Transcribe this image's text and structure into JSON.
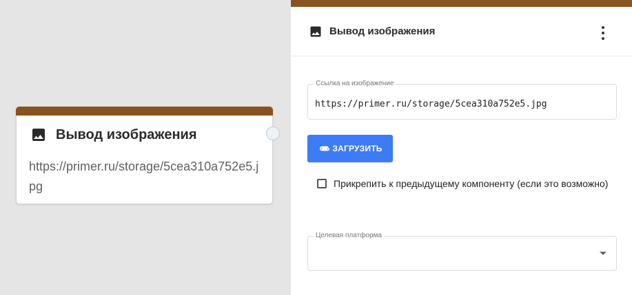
{
  "node": {
    "title": "Вывод изображения",
    "text": "https://primer.ru/storage/5cea310a752e5.jpg",
    "icon": "image-icon",
    "header_color": "#8a521c"
  },
  "panel": {
    "title": "Вывод изображения",
    "icon": "image-icon",
    "menu_icon": "more-vert-icon",
    "url_field": {
      "label": "Ссылка на изображение",
      "value": "https://primer.ru/storage/5cea310a752e5.jpg"
    },
    "upload_button": {
      "label": "ЗАГРУЗИТЬ",
      "icon": "paperclip-icon",
      "color": "#3d7cf5"
    },
    "attach_checkbox": {
      "label": "Прикрепить к предыдущему компоненту (если это возможно)",
      "checked": false
    },
    "platform_field": {
      "label": "Целевая платформа",
      "value": ""
    }
  }
}
